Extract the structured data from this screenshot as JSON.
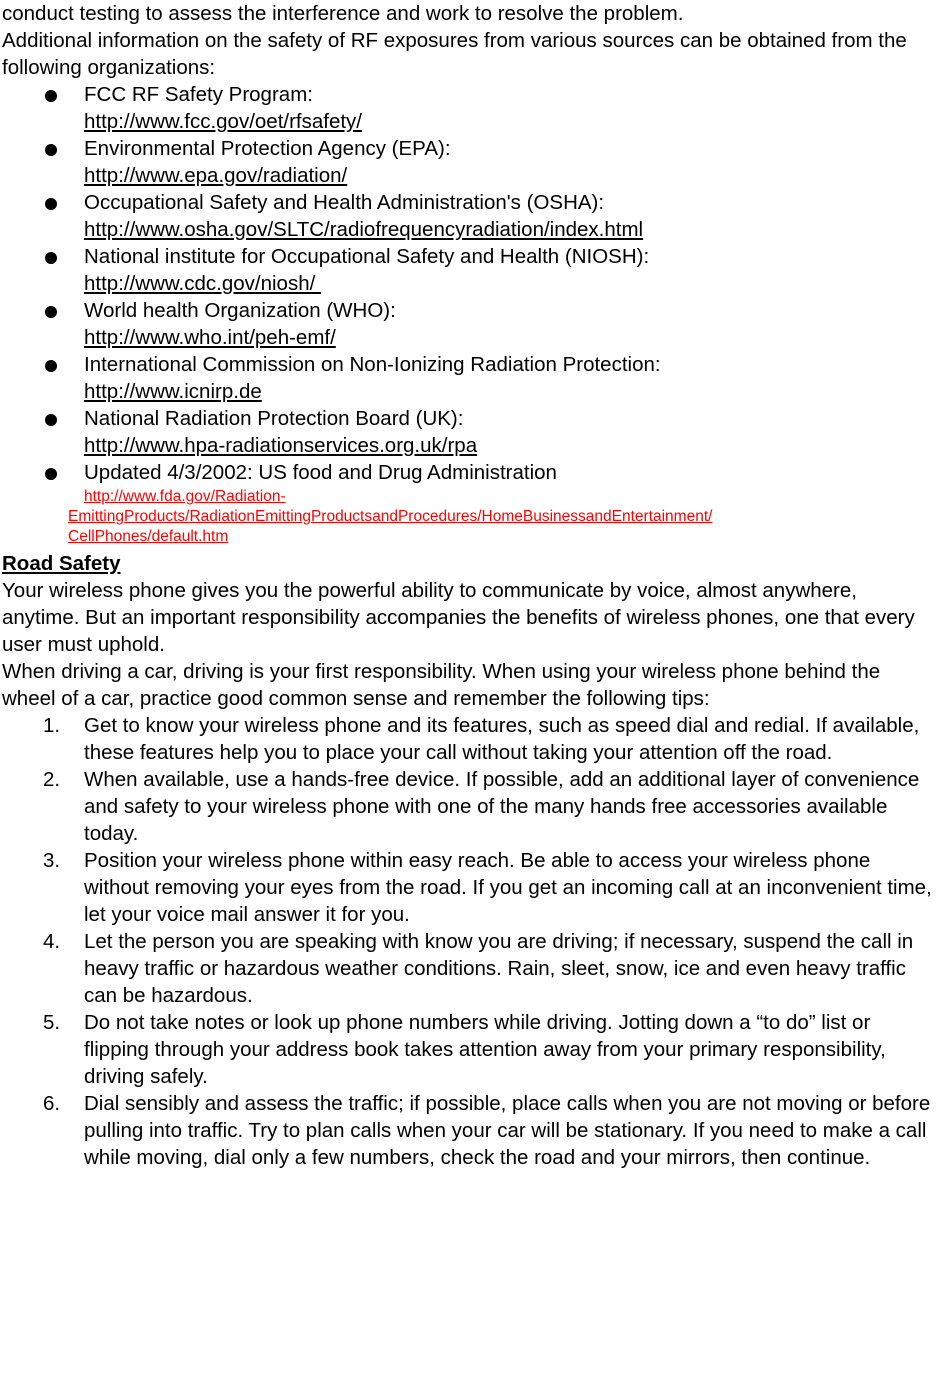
{
  "document": {
    "intro_paragraph": "conduct testing to assess the interference and work to resolve the problem.",
    "intro_paragraph_2": "Additional information on the safety of RF exposures from various sources can be obtained from the following organizations:",
    "organizations": [
      {
        "name": "FCC RF Safety Program:",
        "url": "http://www.fcc.gov/oet/rfsafety/",
        "url_color": "#000000"
      },
      {
        "name": "Environmental Protection Agency (EPA):",
        "url": "http://www.epa.gov/radiation/",
        "url_color": "#000000"
      },
      {
        "name": "Occupational Safety and Health Administration's (OSHA):",
        "url": "http://www.osha.gov/SLTC/radiofrequencyradiation/index.html",
        "url_color": "#000000"
      },
      {
        "name": "National institute for Occupational Safety and Health (NIOSH):",
        "url": "http://www.cdc.gov/niosh/ ",
        "url_color": "#000000"
      },
      {
        "name": "World health Organization (WHO):",
        "url": "http://www.who.int/peh-emf/",
        "url_color": "#000000"
      },
      {
        "name": "International Commission on Non-Ionizing Radiation Protection:",
        "url": "http://www.icnirp.de",
        "url_color": "#000000"
      },
      {
        "name": "National Radiation Protection Board (UK):",
        "url": "http://www.hpa-radiationservices.org.uk/rpa",
        "url_color": "#000000"
      }
    ],
    "fda_item": {
      "name": "Updated 4/3/2002: US food and Drug Administration",
      "url_line_1": "http://www.fda.gov/Radiation-",
      "url_line_2": "EmittingProducts/RadiationEmittingProductsandProcedures/HomeBusinessandEntertainment/",
      "url_line_3": "CellPhones/default.htm",
      "url_color": "#FF0000"
    },
    "road_safety": {
      "heading": "Road Safety",
      "paragraph_1": "Your wireless phone gives you the powerful ability to communicate by voice, almost anywhere, anytime. But an important responsibility accompanies the benefits of wireless phones, one that every user must uphold.",
      "paragraph_2": "When driving a car, driving is your first responsibility. When using your wireless phone behind the wheel of a car, practice good common sense and remember the following tips:",
      "tips": [
        {
          "number": "1.",
          "text": "Get to know your wireless phone and its features, such as speed dial and redial. If available, these features help you to place your call without taking your attention off the road."
        },
        {
          "number": "2.",
          "text": "When available, use a hands-free device. If possible, add an additional layer of convenience and safety to your wireless phone with one of the many hands free accessories available today."
        },
        {
          "number": "3.",
          "text": "Position your wireless phone within easy reach. Be able to access your wireless phone without removing your eyes from the road. If you get an incoming call at an inconvenient time, let your voice mail answer it for you."
        },
        {
          "number": "4.",
          "text": "Let the person you are speaking with know you are driving; if necessary, suspend the call in heavy traffic or hazardous weather conditions. Rain, sleet, snow, ice and even heavy traffic can be hazardous."
        },
        {
          "number": "5.",
          "text": "Do not take notes or look up phone numbers while driving. Jotting down a “to do” list or flipping through your address book takes attention away from your primary responsibility, driving safely."
        },
        {
          "number": "6.",
          "text": "Dial sensibly and assess the traffic; if possible, place calls when you are not moving or before pulling into traffic. Try to plan calls when your car will be stationary. If you need to make a call while moving, dial only a few numbers, check the road and your mirrors, then continue."
        }
      ]
    }
  }
}
